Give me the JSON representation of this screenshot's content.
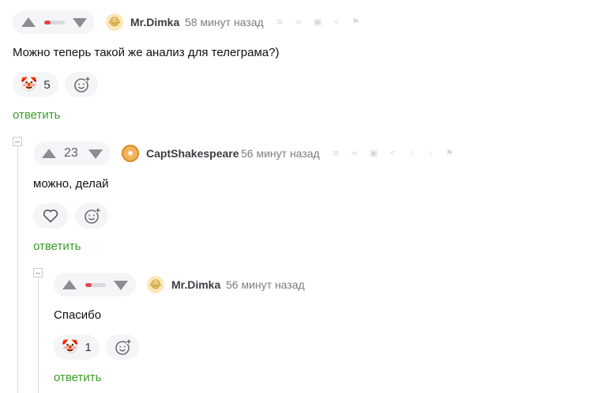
{
  "comments": [
    {
      "user": "Mr.Dimka",
      "time": "58 минут назад",
      "text": "Можно теперь такой же анализ для телеграма?)",
      "rating_fraction": 0.3,
      "reaction": {
        "emoji": "🤡",
        "count": "5"
      },
      "reply_label": "ответить"
    },
    {
      "user": "CaptShakespeare",
      "time": "56 минут назад",
      "score": "23",
      "text": "можно, делай",
      "reply_label": "ответить"
    },
    {
      "user": "Mr.Dimka",
      "time": "56 минут назад",
      "text": "Спасибо",
      "rating_fraction": 0.3,
      "reaction": {
        "emoji": "🤡",
        "count": "1"
      },
      "reply_label": "ответить"
    }
  ],
  "icons": {
    "upvote": "triangle-up",
    "downvote": "triangle-down",
    "add_reaction": "smile-plus",
    "like": "heart",
    "rss": "rss",
    "link": "link",
    "save": "floppy-disk",
    "share": "share",
    "report": "flag"
  },
  "colors": {
    "reply": "#3c9c29",
    "rating_negative": "#e4454d",
    "pill_bg": "#f4f5f6"
  }
}
